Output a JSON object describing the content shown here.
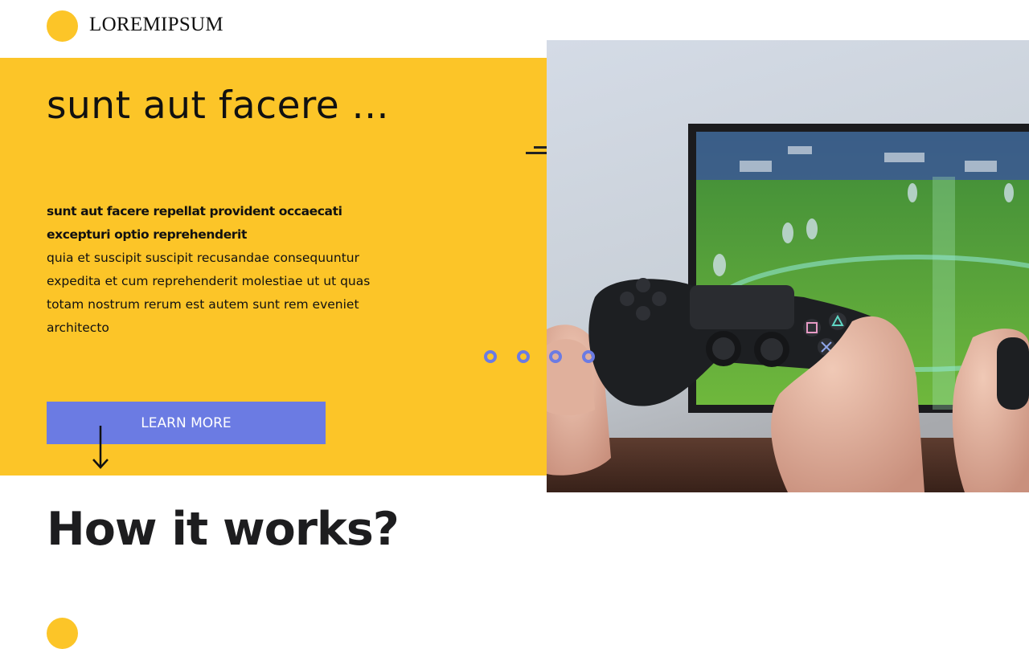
{
  "brand": {
    "name": "LOREMIPSUM"
  },
  "hero": {
    "title": "sunt aut facere ...",
    "lead_bold": "sunt aut facere repellat provident occaecati excepturi optio reprehenderit",
    "body": "quia et suscipit suscipit recusandae consequuntur expedita et cum reprehenderit molestiae ut ut quas totam nostrum rerum est autem sunt rem eveniet architecto",
    "cta_label": "LEARN MORE",
    "slides_count": 4
  },
  "section": {
    "title": "How it works?"
  },
  "colors": {
    "accent_yellow": "#fcc528",
    "accent_blue": "#6b7be3",
    "text_dark": "#111111"
  },
  "icons": {
    "arrow": "arrow-down-icon",
    "image": "game-controller-photo"
  }
}
